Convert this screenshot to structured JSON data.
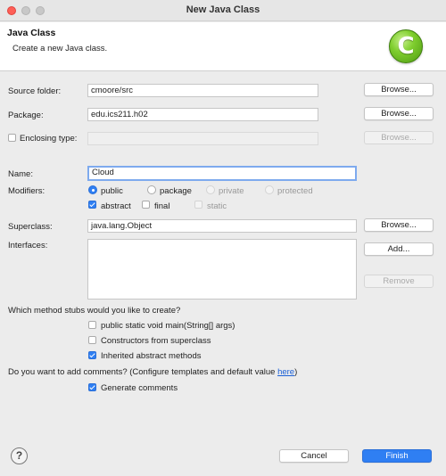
{
  "window": {
    "title": "New Java Class"
  },
  "banner": {
    "title": "Java Class",
    "description": "Create a new Java class.",
    "logo_letter": "C"
  },
  "source_folder": {
    "label": "Source folder:",
    "value": "cmoore/src",
    "button": "Browse..."
  },
  "package": {
    "label": "Package:",
    "value": "edu.ics211.h02",
    "button": "Browse..."
  },
  "enclosing_type": {
    "label": "Enclosing type:",
    "value": "",
    "button": "Browse...",
    "checked": false
  },
  "name": {
    "label": "Name:",
    "value": "Cloud"
  },
  "modifiers": {
    "label": "Modifiers:",
    "access": [
      {
        "label": "public",
        "selected": true,
        "enabled": true
      },
      {
        "label": "package",
        "selected": false,
        "enabled": true
      },
      {
        "label": "private",
        "selected": false,
        "enabled": false
      },
      {
        "label": "protected",
        "selected": false,
        "enabled": false
      }
    ],
    "flags": [
      {
        "label": "abstract",
        "checked": true,
        "enabled": true
      },
      {
        "label": "final",
        "checked": false,
        "enabled": true
      },
      {
        "label": "static",
        "checked": false,
        "enabled": false
      }
    ]
  },
  "superclass": {
    "label": "Superclass:",
    "value": "java.lang.Object",
    "button": "Browse..."
  },
  "interfaces": {
    "label": "Interfaces:",
    "add_button": "Add...",
    "remove_button": "Remove"
  },
  "method_stubs": {
    "question": "Which method stubs would you like to create?",
    "options": [
      {
        "label": "public static void main(String[] args)",
        "checked": false
      },
      {
        "label": "Constructors from superclass",
        "checked": false
      },
      {
        "label": "Inherited abstract methods",
        "checked": true
      }
    ]
  },
  "comments": {
    "question": "Do you want to add comments? (Configure templates and default value ",
    "link": "here",
    "question_end": ")",
    "option": {
      "label": "Generate comments",
      "checked": true
    }
  },
  "footer": {
    "help": "?",
    "cancel": "Cancel",
    "finish": "Finish"
  }
}
